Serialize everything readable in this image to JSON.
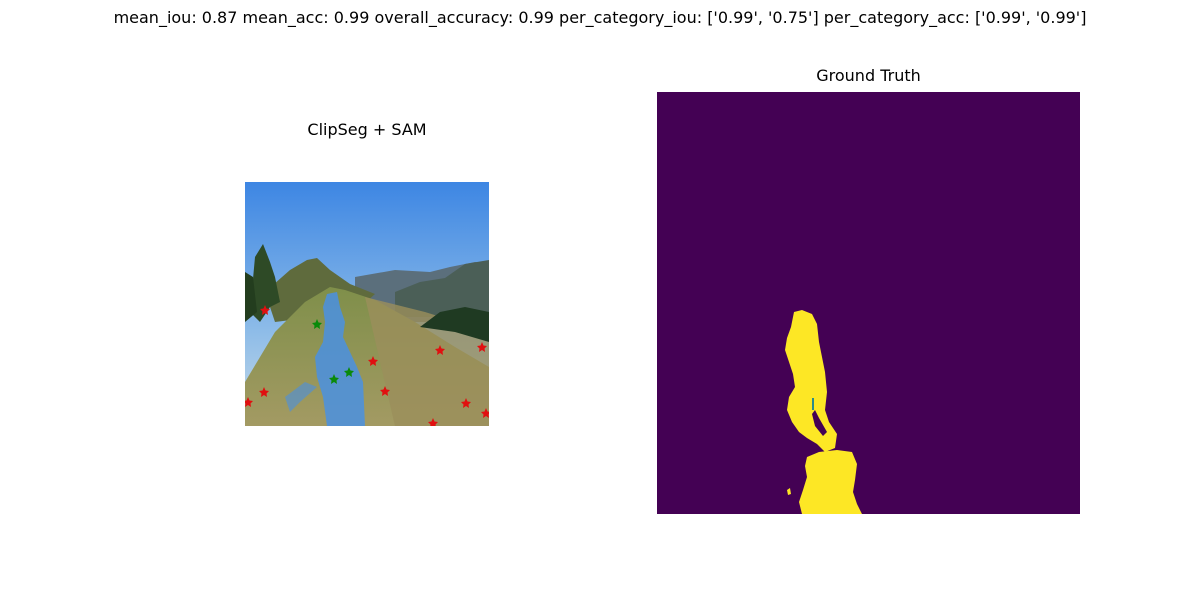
{
  "figure": {
    "suptitle": "mean_iou: 0.87  mean_acc: 0.99  overall_accuracy: 0.99  per_category_iou: ['0.99', '0.75']  per_category_acc: ['0.99', '0.99']"
  },
  "panels": [
    {
      "title": "ClipSeg + SAM"
    },
    {
      "title": "Ground Truth"
    }
  ],
  "colors": {
    "mask_background": "#440154",
    "mask_foreground": "#fde725",
    "overlay": "#4a90e2",
    "positive_point": "#0a8a0a",
    "negative_point": "#e01010"
  }
}
